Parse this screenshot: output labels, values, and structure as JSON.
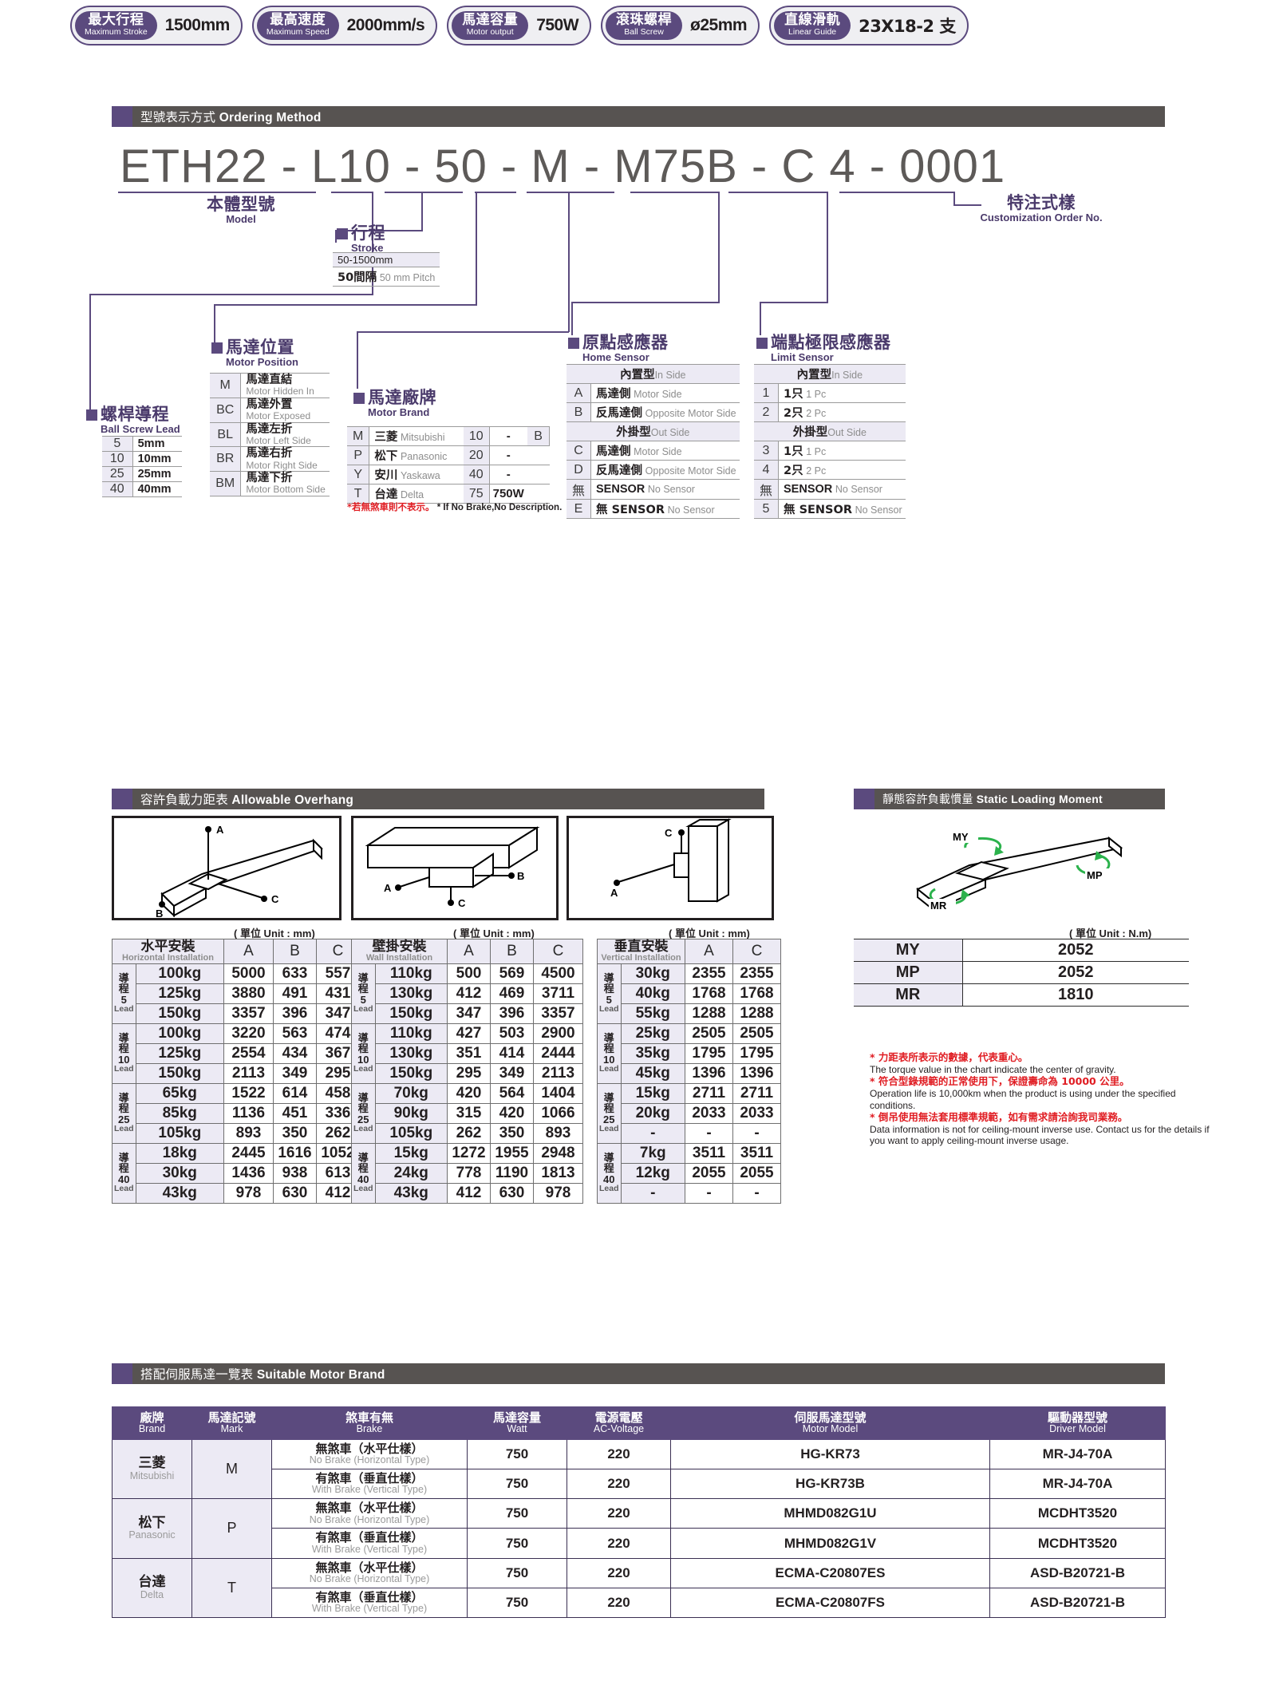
{
  "spec_badges": [
    {
      "cn": "最大行程",
      "en": "Maximum Stroke",
      "value": "1500mm"
    },
    {
      "cn": "最高速度",
      "en": "Maximum Speed",
      "value": "2000mm/s"
    },
    {
      "cn": "馬達容量",
      "en": "Motor output",
      "value": "750W"
    },
    {
      "cn": "滾珠螺桿",
      "en": "Ball Screw",
      "value": "ø25mm"
    },
    {
      "cn": "直線滑軌",
      "en": "Linear Guide",
      "value": "23X18-2 支"
    }
  ],
  "sections": {
    "ordering": {
      "cn": "型號表示方式",
      "en": "Ordering Method"
    },
    "overhang": {
      "cn": "容許負載力距表",
      "en": "Allowable Overhang"
    },
    "static_moment": {
      "cn": "靜態容許負載慣量",
      "en": "Static Loading Moment"
    },
    "motor_brand": {
      "cn": "搭配伺服馬達一覽表",
      "en": "Suitable Motor Brand"
    }
  },
  "ordering": {
    "code": "ETH22 - L10 - 50  -  M - M75B - C 4 - 0001",
    "model": {
      "cn": "本體型號",
      "en": "Model"
    },
    "customization": {
      "cn": "特注式樣",
      "en": "Customization Order No."
    },
    "stroke": {
      "cn": "行程",
      "en": "Stroke",
      "rows": [
        {
          "value": "50-1500mm"
        },
        {
          "bold": "50間隔",
          "gray": "50 mm Pitch"
        }
      ]
    },
    "ball_screw_lead": {
      "cn": "螺桿導程",
      "en": "Ball Screw Lead",
      "rows": [
        {
          "key": "5",
          "val": "5mm"
        },
        {
          "key": "10",
          "val": "10mm"
        },
        {
          "key": "25",
          "val": "25mm"
        },
        {
          "key": "40",
          "val": "40mm"
        }
      ]
    },
    "motor_position": {
      "cn": "馬達位置",
      "en": "Motor Position",
      "rows": [
        {
          "key": "M",
          "cn": "馬達直結",
          "en": "Motor Hidden In"
        },
        {
          "key": "BC",
          "cn": "馬達外置",
          "en": "Motor Exposed"
        },
        {
          "key": "BL",
          "cn": "馬達左折",
          "en": "Motor Left Side"
        },
        {
          "key": "BR",
          "cn": "馬達右折",
          "en": "Motor Right Side"
        },
        {
          "key": "BM",
          "cn": "馬達下折",
          "en": "Motor Bottom Side"
        }
      ]
    },
    "motor_brand": {
      "cn": "馬達廠牌",
      "en": "Motor Brand",
      "rows": [
        {
          "key": "M",
          "cn": "三菱",
          "en": "Mitsubishi",
          "num": "10",
          "watt": "-",
          "brake": "B"
        },
        {
          "key": "P",
          "cn": "松下",
          "en": "Panasonic",
          "num": "20",
          "watt": "-",
          "brake": ""
        },
        {
          "key": "Y",
          "cn": "安川",
          "en": "Yaskawa",
          "num": "40",
          "watt": "-",
          "brake": ""
        },
        {
          "key": "T",
          "cn": "台達",
          "en": "Delta",
          "num": "75",
          "watt": "750W",
          "brake": ""
        }
      ],
      "note_cn": "*若無煞車則不表示。",
      "note_en": "* If No Brake,No Description."
    },
    "home_sensor": {
      "cn": "原點感應器",
      "en": "Home Sensor",
      "group_in": {
        "cn": "內置型",
        "en": "In Side"
      },
      "group_out": {
        "cn": "外掛型",
        "en": "Out Side"
      },
      "rows_in": [
        {
          "key": "A",
          "cn": "馬達側",
          "en": "Motor Side"
        },
        {
          "key": "B",
          "cn": "反馬達側",
          "en": "Opposite Motor Side"
        }
      ],
      "rows_out": [
        {
          "key": "C",
          "cn": "馬達側",
          "en": "Motor Side"
        },
        {
          "key": "D",
          "cn": "反馬達側",
          "en": "Opposite Motor Side"
        },
        {
          "key": "無",
          "cn": "SENSOR",
          "en": "No Sensor"
        },
        {
          "key": "E",
          "cn": "無 SENSOR",
          "en": "No Sensor"
        }
      ]
    },
    "limit_sensor": {
      "cn": "端點極限感應器",
      "en": "Limit Sensor",
      "group_in": {
        "cn": "內置型",
        "en": "In Side"
      },
      "group_out": {
        "cn": "外掛型",
        "en": "Out Side"
      },
      "rows_in": [
        {
          "key": "1",
          "cn": "1只",
          "en": "1 Pc"
        },
        {
          "key": "2",
          "cn": "2只",
          "en": "2 Pc"
        }
      ],
      "rows_out": [
        {
          "key": "3",
          "cn": "1只",
          "en": "1 Pc"
        },
        {
          "key": "4",
          "cn": "2只",
          "en": "2 Pc"
        },
        {
          "key": "無",
          "cn": "SENSOR",
          "en": "No Sensor"
        },
        {
          "key": "5",
          "cn": "無 SENSOR",
          "en": "No Sensor"
        }
      ]
    }
  },
  "overhang": {
    "unit_label": "( 單位 Unit : mm)",
    "tables": [
      {
        "name_cn": "水平安裝",
        "name_en": "Horizontal Installation",
        "cols": [
          "A",
          "B",
          "C"
        ],
        "groups": [
          {
            "lead": "5",
            "rows": [
              {
                "kg": "100kg",
                "v": [
                  "5000",
                  "633",
                  "557"
                ]
              },
              {
                "kg": "125kg",
                "v": [
                  "3880",
                  "491",
                  "431"
                ]
              },
              {
                "kg": "150kg",
                "v": [
                  "3357",
                  "396",
                  "347"
                ]
              }
            ]
          },
          {
            "lead": "10",
            "rows": [
              {
                "kg": "100kg",
                "v": [
                  "3220",
                  "563",
                  "474"
                ]
              },
              {
                "kg": "125kg",
                "v": [
                  "2554",
                  "434",
                  "367"
                ]
              },
              {
                "kg": "150kg",
                "v": [
                  "2113",
                  "349",
                  "295"
                ]
              }
            ]
          },
          {
            "lead": "25",
            "rows": [
              {
                "kg": "65kg",
                "v": [
                  "1522",
                  "614",
                  "458"
                ]
              },
              {
                "kg": "85kg",
                "v": [
                  "1136",
                  "451",
                  "336"
                ]
              },
              {
                "kg": "105kg",
                "v": [
                  "893",
                  "350",
                  "262"
                ]
              }
            ]
          },
          {
            "lead": "40",
            "rows": [
              {
                "kg": "18kg",
                "v": [
                  "2445",
                  "1616",
                  "1052"
                ]
              },
              {
                "kg": "30kg",
                "v": [
                  "1436",
                  "938",
                  "613"
                ]
              },
              {
                "kg": "43kg",
                "v": [
                  "978",
                  "630",
                  "412"
                ]
              }
            ]
          }
        ]
      },
      {
        "name_cn": "壁掛安裝",
        "name_en": "Wall Installation",
        "cols": [
          "A",
          "B",
          "C"
        ],
        "groups": [
          {
            "lead": "5",
            "rows": [
              {
                "kg": "110kg",
                "v": [
                  "500",
                  "569",
                  "4500"
                ]
              },
              {
                "kg": "130kg",
                "v": [
                  "412",
                  "469",
                  "3711"
                ]
              },
              {
                "kg": "150kg",
                "v": [
                  "347",
                  "396",
                  "3357"
                ]
              }
            ]
          },
          {
            "lead": "10",
            "rows": [
              {
                "kg": "110kg",
                "v": [
                  "427",
                  "503",
                  "2900"
                ]
              },
              {
                "kg": "130kg",
                "v": [
                  "351",
                  "414",
                  "2444"
                ]
              },
              {
                "kg": "150kg",
                "v": [
                  "295",
                  "349",
                  "2113"
                ]
              }
            ]
          },
          {
            "lead": "25",
            "rows": [
              {
                "kg": "70kg",
                "v": [
                  "420",
                  "564",
                  "1404"
                ]
              },
              {
                "kg": "90kg",
                "v": [
                  "315",
                  "420",
                  "1066"
                ]
              },
              {
                "kg": "105kg",
                "v": [
                  "262",
                  "350",
                  "893"
                ]
              }
            ]
          },
          {
            "lead": "40",
            "rows": [
              {
                "kg": "15kg",
                "v": [
                  "1272",
                  "1955",
                  "2948"
                ]
              },
              {
                "kg": "24kg",
                "v": [
                  "778",
                  "1190",
                  "1813"
                ]
              },
              {
                "kg": "43kg",
                "v": [
                  "412",
                  "630",
                  "978"
                ]
              }
            ]
          }
        ]
      },
      {
        "name_cn": "垂直安裝",
        "name_en": "Vertical Installation",
        "cols": [
          "A",
          "C"
        ],
        "groups": [
          {
            "lead": "5",
            "rows": [
              {
                "kg": "30kg",
                "v": [
                  "2355",
                  "2355"
                ]
              },
              {
                "kg": "40kg",
                "v": [
                  "1768",
                  "1768"
                ]
              },
              {
                "kg": "55kg",
                "v": [
                  "1288",
                  "1288"
                ]
              }
            ]
          },
          {
            "lead": "10",
            "rows": [
              {
                "kg": "25kg",
                "v": [
                  "2505",
                  "2505"
                ]
              },
              {
                "kg": "35kg",
                "v": [
                  "1795",
                  "1795"
                ]
              },
              {
                "kg": "45kg",
                "v": [
                  "1396",
                  "1396"
                ]
              }
            ]
          },
          {
            "lead": "25",
            "rows": [
              {
                "kg": "15kg",
                "v": [
                  "2711",
                  "2711"
                ]
              },
              {
                "kg": "20kg",
                "v": [
                  "2033",
                  "2033"
                ]
              },
              {
                "kg": "-",
                "v": [
                  "-",
                  "-"
                ]
              }
            ]
          },
          {
            "lead": "40",
            "rows": [
              {
                "kg": "7kg",
                "v": [
                  "3511",
                  "3511"
                ]
              },
              {
                "kg": "12kg",
                "v": [
                  "2055",
                  "2055"
                ]
              },
              {
                "kg": "-",
                "v": [
                  "-",
                  "-"
                ]
              }
            ]
          }
        ]
      }
    ],
    "lead_label_cn": "導程",
    "lead_label_en": "Lead",
    "diagram_points": [
      "A",
      "B",
      "C"
    ]
  },
  "static_moment": {
    "unit_label": "( 單位 Unit : N.m)",
    "diagram_labels": [
      "MY",
      "MP",
      "MR"
    ],
    "rows": [
      {
        "key": "MY",
        "value": "2052"
      },
      {
        "key": "MP",
        "value": "2052"
      },
      {
        "key": "MR",
        "value": "1810"
      }
    ],
    "notes": [
      {
        "cn": "* 力距表所表示的數據，代表重心。",
        "en": "The torque value in the chart indicate the center of gravity."
      },
      {
        "cn": "* 符合型錄規範的正常使用下，保證壽命為 10000 公里。",
        "en": "Operation life is 10,000km when the product is using under the specified conditions."
      },
      {
        "cn": "* 倒吊使用無法套用標準規範，如有需求請洽詢我司業務。",
        "en": "Data information is not for ceiling-mount inverse use. Contact us for the details if you want to apply ceiling-mount inverse usage."
      }
    ]
  },
  "motor_table": {
    "headers": [
      {
        "cn": "廠牌",
        "en": "Brand"
      },
      {
        "cn": "馬達記號",
        "en": "Mark"
      },
      {
        "cn": "煞車有無",
        "en": "Brake"
      },
      {
        "cn": "馬達容量",
        "en": "Watt"
      },
      {
        "cn": "電源電壓",
        "en": "AC-Voltage"
      },
      {
        "cn": "伺服馬達型號",
        "en": "Motor Model"
      },
      {
        "cn": "驅動器型號",
        "en": "Driver Model"
      }
    ],
    "brands": [
      {
        "cn": "三菱",
        "en": "Mitsubishi",
        "mark": "M",
        "rows": [
          {
            "brake_cn": "無煞車（水平仕樣）",
            "brake_en": "No Brake (Horizontal Type)",
            "watt": "750",
            "volt": "220",
            "motor": "HG-KR73",
            "driver": "MR-J4-70A"
          },
          {
            "brake_cn": "有煞車（垂直仕樣）",
            "brake_en": "With Brake (Vertical Type)",
            "watt": "750",
            "volt": "220",
            "motor": "HG-KR73B",
            "driver": "MR-J4-70A"
          }
        ]
      },
      {
        "cn": "松下",
        "en": "Panasonic",
        "mark": "P",
        "rows": [
          {
            "brake_cn": "無煞車（水平仕樣）",
            "brake_en": "No Brake (Horizontal Type)",
            "watt": "750",
            "volt": "220",
            "motor": "MHMD082G1U",
            "driver": "MCDHT3520"
          },
          {
            "brake_cn": "有煞車（垂直仕樣）",
            "brake_en": "With Brake (Vertical Type)",
            "watt": "750",
            "volt": "220",
            "motor": "MHMD082G1V",
            "driver": "MCDHT3520"
          }
        ]
      },
      {
        "cn": "台達",
        "en": "Delta",
        "mark": "T",
        "rows": [
          {
            "brake_cn": "無煞車（水平仕樣）",
            "brake_en": "No Brake (Horizontal Type)",
            "watt": "750",
            "volt": "220",
            "motor": "ECMA-C20807ES",
            "driver": "ASD-B20721-B"
          },
          {
            "brake_cn": "有煞車（垂直仕樣）",
            "brake_en": "With Brake (Vertical Type)",
            "watt": "750",
            "volt": "220",
            "motor": "ECMA-C20807FS",
            "driver": "ASD-B20721-B"
          }
        ]
      }
    ]
  },
  "colors": {
    "purple": "#5b4a7e",
    "purple_dark": "#4a3a6b",
    "banner_gray": "#575351",
    "light_lavender": "#eceaf4",
    "red": "#e01c22"
  }
}
